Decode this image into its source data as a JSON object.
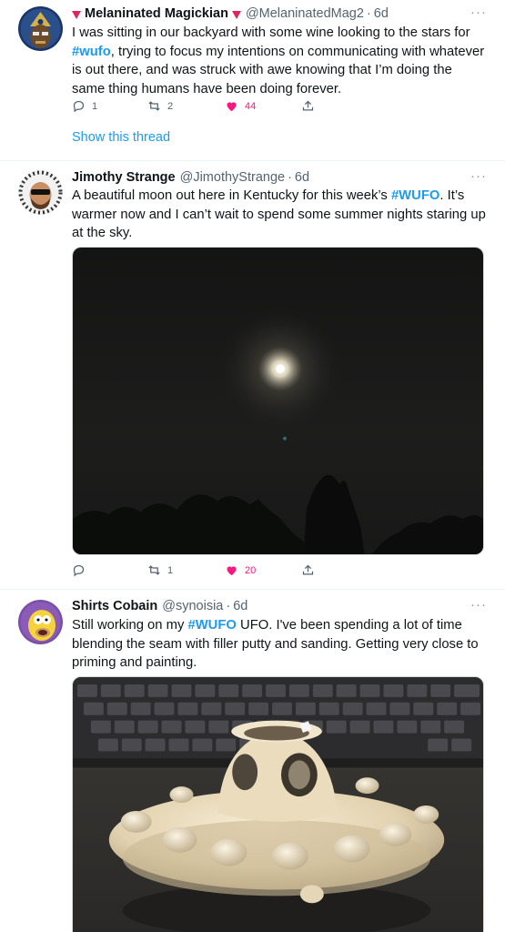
{
  "tweets": [
    {
      "name": "Melaninated Magickian",
      "handle": "@MelaninatedMag2",
      "dot": "·",
      "time": "6d",
      "more": "···",
      "text_parts": [
        "I was sitting in our backyard with some wine looking to the stars for ",
        "#wufo",
        ", trying to focus my intentions on communicating with whatever is out there, and was struck with awe knowing that I’m doing the same thing humans have been doing forever."
      ],
      "replies": "1",
      "retweets": "2",
      "likes": "44",
      "show_thread": "Show this thread"
    },
    {
      "name": "Jimothy Strange",
      "handle": "@JimothyStrange",
      "dot": "·",
      "time": "6d",
      "more": "···",
      "text_parts": [
        "A beautiful moon out here in Kentucky for this week’s ",
        "#WUFO",
        ". It’s warmer now and I can’t wait to spend some summer nights staring up at the sky."
      ],
      "replies": "",
      "retweets": "1",
      "likes": "20"
    },
    {
      "name": "Shirts Cobain",
      "handle": "@synoisia",
      "dot": "·",
      "time": "6d",
      "more": "···",
      "text_parts": [
        "Still working on my ",
        "#WUFO",
        " UFO. I've been spending a lot of time blending the seam with filler putty and sanding. Getting very close to priming and painting."
      ]
    }
  ],
  "colors": {
    "link": "#1d9bf0",
    "like": "#f91880",
    "secondary_text": "#536471",
    "divider": "#eff3f4"
  },
  "icons": [
    "reply-icon",
    "retweet-icon",
    "like-icon",
    "share-icon",
    "more-icon"
  ]
}
